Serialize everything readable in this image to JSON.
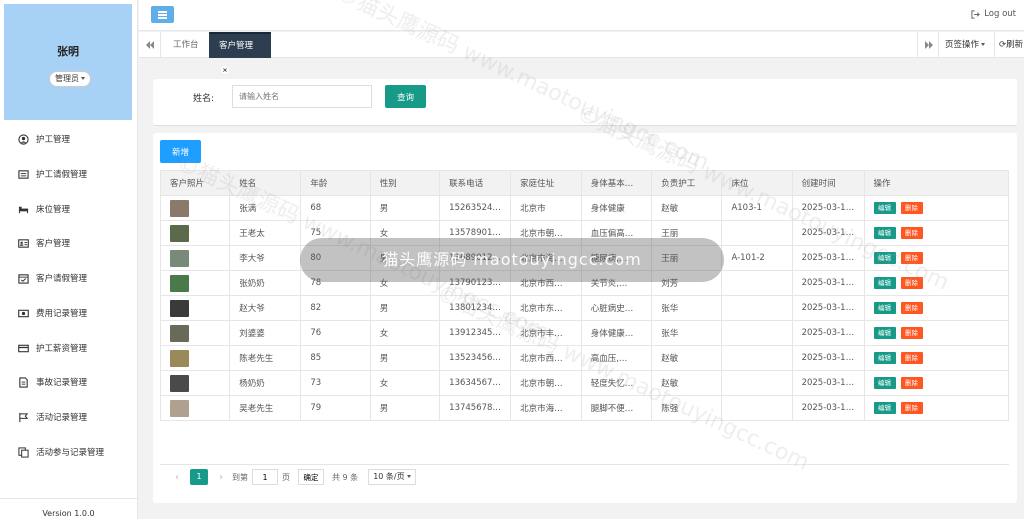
{
  "user": {
    "name": "张明",
    "role": "管理员"
  },
  "menu": [
    {
      "label": "护工管理",
      "icon": "user-circle-icon"
    },
    {
      "label": "护工请假管理",
      "icon": "list-icon"
    },
    {
      "label": "床位管理",
      "icon": "bed-icon"
    },
    {
      "label": "客户管理",
      "icon": "id-card-icon"
    },
    {
      "label": "客户请假管理",
      "icon": "calendar-check-icon"
    },
    {
      "label": "费用记录管理",
      "icon": "money-icon"
    },
    {
      "label": "护工薪资管理",
      "icon": "credit-card-icon"
    },
    {
      "label": "事故记录管理",
      "icon": "document-icon"
    },
    {
      "label": "活动记录管理",
      "icon": "flag-icon"
    },
    {
      "label": "活动参与记录管理",
      "icon": "copy-icon"
    }
  ],
  "version": "Version 1.0.0",
  "header": {
    "logout": "Log out"
  },
  "tabs": {
    "work": "工作台",
    "active": "客户管理",
    "ops": "页签操作",
    "refresh": "刷新"
  },
  "search": {
    "label": "姓名:",
    "placeholder": "请输入姓名",
    "button": "查询"
  },
  "table": {
    "add_button": "新增",
    "columns": [
      "客户照片",
      "姓名",
      "年龄",
      "性别",
      "联系电话",
      "家庭住址",
      "身体基本…",
      "负责护工",
      "床位",
      "创建时间",
      "操作"
    ],
    "edit_label": "编辑",
    "delete_label": "删除",
    "rows": [
      {
        "name": "张满",
        "age": "68",
        "gender": "男",
        "phone": "15263524…",
        "address": "北京市",
        "health": "身体健康",
        "nurse": "赵敏",
        "bed": "A103-1",
        "created": "2025-03-1…",
        "photo": "#8a7a6a"
      },
      {
        "name": "王老太",
        "age": "75",
        "gender": "女",
        "phone": "13578901…",
        "address": "北京市朝…",
        "health": "血压偏高…",
        "nurse": "王丽",
        "bed": "",
        "created": "2025-03-1…",
        "photo": "#5a6a4a"
      },
      {
        "name": "李大爷",
        "age": "80",
        "gender": "男",
        "phone": "13689012…",
        "address": "北京市海…",
        "health": "糖尿病,…",
        "nurse": "王丽",
        "bed": "A-101-2",
        "created": "2025-03-1…",
        "photo": "#7a8a7a"
      },
      {
        "name": "张奶奶",
        "age": "78",
        "gender": "女",
        "phone": "13790123…",
        "address": "北京市西…",
        "health": "关节炎,…",
        "nurse": "刘芳",
        "bed": "",
        "created": "2025-03-1…",
        "photo": "#4a7a4a"
      },
      {
        "name": "赵大爷",
        "age": "82",
        "gender": "男",
        "phone": "13801234…",
        "address": "北京市东…",
        "health": "心脏病史…",
        "nurse": "张华",
        "bed": "",
        "created": "2025-03-1…",
        "photo": "#3a3a3a"
      },
      {
        "name": "刘婆婆",
        "age": "76",
        "gender": "女",
        "phone": "13912345…",
        "address": "北京市丰…",
        "health": "身体健康…",
        "nurse": "张华",
        "bed": "",
        "created": "2025-03-1…",
        "photo": "#6a6a5a"
      },
      {
        "name": "陈老先生",
        "age": "85",
        "gender": "男",
        "phone": "13523456…",
        "address": "北京市西…",
        "health": "高血压,…",
        "nurse": "赵敏",
        "bed": "",
        "created": "2025-03-1…",
        "photo": "#9a8a5a"
      },
      {
        "name": "杨奶奶",
        "age": "73",
        "gender": "女",
        "phone": "13634567…",
        "address": "北京市朝…",
        "health": "轻度失忆…",
        "nurse": "赵敏",
        "bed": "",
        "created": "2025-03-1…",
        "photo": "#4a4a4a"
      },
      {
        "name": "吴老先生",
        "age": "79",
        "gender": "男",
        "phone": "13745678…",
        "address": "北京市海…",
        "health": "腿脚不便…",
        "nurse": "陈强",
        "bed": "",
        "created": "2025-03-1…",
        "photo": "#b0a090"
      }
    ]
  },
  "pager": {
    "current": "1",
    "goto": "到第",
    "page_input": "1",
    "page_unit": "页",
    "confirm": "确定",
    "total": "共 9 条",
    "page_size": "10 条/页"
  },
  "watermark": {
    "text": "猫头鹰源码  maotouyingcc.com",
    "diag": "©猫头鹰源码 www.maotouyingcc.com"
  }
}
